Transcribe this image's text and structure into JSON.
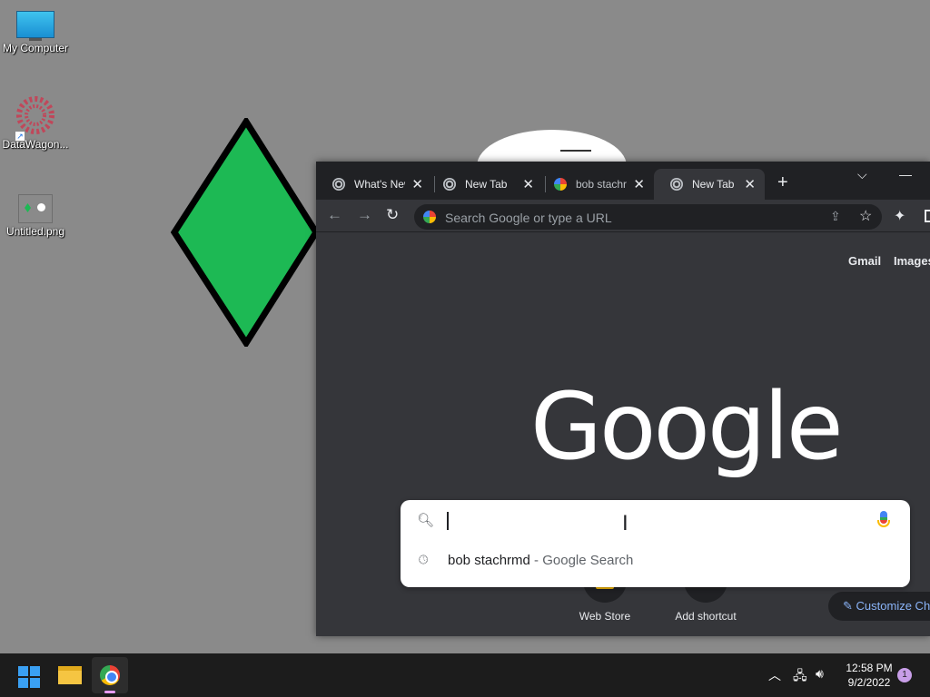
{
  "desktop": {
    "icons": [
      {
        "label": "My Computer",
        "icon": "computer-icon"
      },
      {
        "label": "DataWagon...",
        "icon": "datawagon-icon"
      },
      {
        "label": "Untitled.png",
        "icon": "image-file-icon"
      }
    ],
    "diamond_color": "#1db954"
  },
  "browser": {
    "tabs": [
      {
        "label": "What's New",
        "icon": "chrome-icon"
      },
      {
        "label": "New Tab",
        "icon": "chrome-icon"
      },
      {
        "label": "bob stachrmd",
        "icon": "google-icon"
      },
      {
        "label": "New Tab",
        "icon": "chrome-icon",
        "active": true
      }
    ],
    "new_tab": "+",
    "omnibox": {
      "placeholder": "Search Google or type a URL"
    },
    "ntp": {
      "links": [
        "Gmail",
        "Images"
      ],
      "logo": "Google",
      "shortcuts": [
        {
          "label": "Web Store",
          "icon": "web-store-icon"
        },
        {
          "label": "Add shortcut",
          "icon": "plus-icon"
        }
      ],
      "customize": "Customize Chrome"
    },
    "search": {
      "suggestion_query": "bob stachrmd",
      "suggestion_suffix": " - Google Search"
    }
  },
  "taskbar": {
    "time": "12:58 PM",
    "date": "9/2/2022",
    "notification_count": "1"
  }
}
